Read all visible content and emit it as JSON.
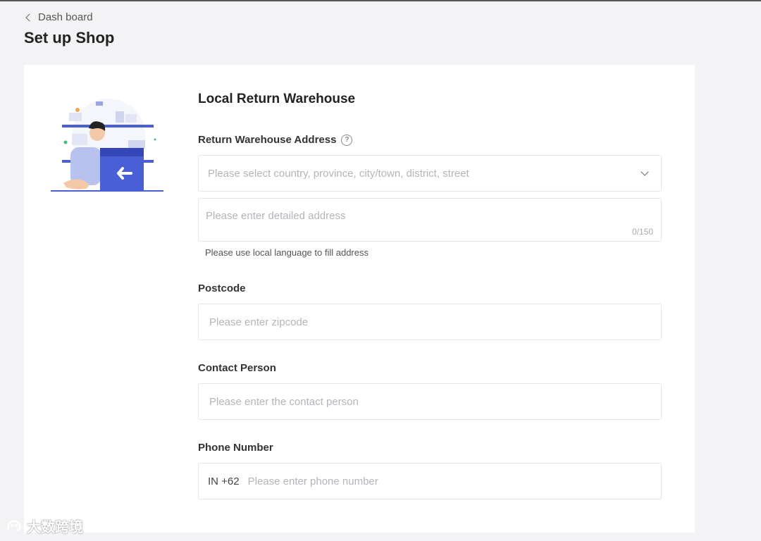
{
  "breadcrumb": {
    "back_label": "Dash board"
  },
  "header": {
    "title": "Set up Shop"
  },
  "form": {
    "section_title": "Local Return Warehouse",
    "address": {
      "label": "Return Warehouse Address",
      "select_placeholder": "Please select country, province, city/town, district, street",
      "detail_placeholder": "Please enter detailed address",
      "counter": "0/150",
      "hint": "Please use local language to fill address"
    },
    "postcode": {
      "label": "Postcode",
      "placeholder": "Please enter zipcode"
    },
    "contact": {
      "label": "Contact Person",
      "placeholder": "Please enter the contact person"
    },
    "phone": {
      "label": "Phone Number",
      "prefix": "IN +62",
      "placeholder": "Please enter phone number"
    }
  },
  "watermark": {
    "text": "大数跨境"
  },
  "icons": {
    "back": "chevron-left-icon",
    "help": "question-circle-icon",
    "dropdown": "chevron-down-icon",
    "illustration": "warehouse-return-illustration"
  },
  "colors": {
    "accent": "#4a5fd6",
    "page_bg": "#f3f3f5",
    "card_bg": "#ffffff",
    "placeholder": "#b4b4ba"
  }
}
